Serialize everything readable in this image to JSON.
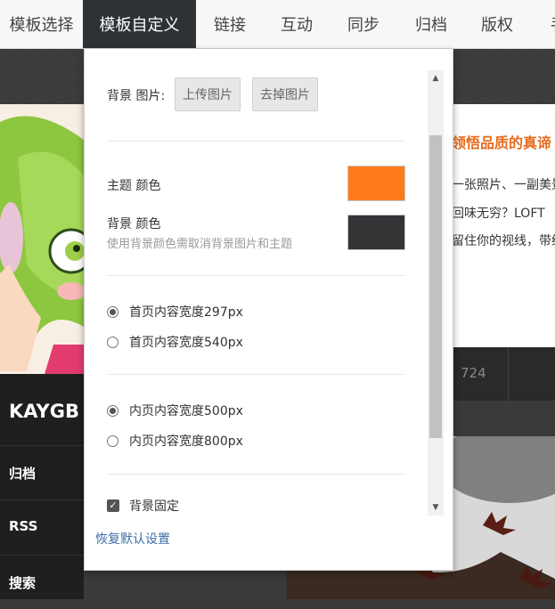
{
  "tabs": [
    {
      "label": "模板选择"
    },
    {
      "label": "模板自定义"
    },
    {
      "label": "链接"
    },
    {
      "label": "互动"
    },
    {
      "label": "同步"
    },
    {
      "label": "归档"
    },
    {
      "label": "版权"
    },
    {
      "label": "手"
    }
  ],
  "background": {
    "headline": "领悟品质的真谛",
    "lines": [
      "一张照片、一副美景",
      "回味无穷？LOFT",
      "留住你的视线，带给"
    ],
    "count": "724",
    "brand": "KAYGB",
    "side_items": [
      "归档",
      "RSS",
      "搜索"
    ]
  },
  "panel": {
    "bg_image_label": "背景 图片:",
    "upload_button": "上传图片",
    "remove_button": "去掉图片",
    "theme_color_label": "主题 颜色",
    "theme_color": "#ff7a1a",
    "bg_color_label": "背景 颜色",
    "bg_color_hint": "使用背景颜色需取消背景图片和主题",
    "bg_color": "#333436",
    "home_width_options": [
      {
        "label": "首页内容宽度297px",
        "checked": true
      },
      {
        "label": "首页内容宽度540px",
        "checked": false
      }
    ],
    "inner_width_options": [
      {
        "label": "内页内容宽度500px",
        "checked": true
      },
      {
        "label": "内页内容宽度800px",
        "checked": false
      }
    ],
    "fixed_bg_label": "背景固定",
    "fixed_bg_checked": true,
    "reset_label": "恢复默认设置"
  }
}
